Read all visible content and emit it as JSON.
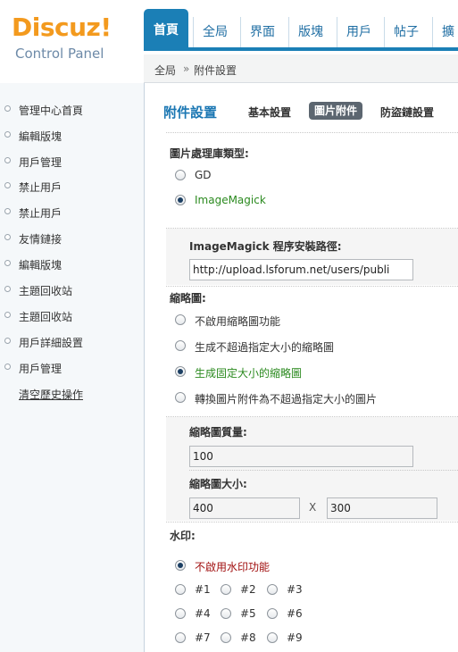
{
  "logo": {
    "title": "Discuz!",
    "subtitle": "Control Panel"
  },
  "top_tabs": [
    "首頁",
    "全局",
    "界面",
    "版塊",
    "用戶",
    "帖子",
    "擴"
  ],
  "breadcrumb": {
    "root": "全局",
    "sep": "»",
    "current": "附件設置"
  },
  "sidebar": {
    "items": [
      "管理中心首頁",
      "編輯版塊",
      "用戶管理",
      "禁止用戶",
      "禁止用戶",
      "友情鏈接",
      "編輯版塊",
      "主題回收站",
      "主題回收站",
      "用戶詳細設置",
      "用戶管理"
    ],
    "clear_history": "清空歷史操作"
  },
  "section": {
    "title": "附件設置",
    "tabs": [
      "基本設置",
      "圖片附件",
      "防盜鏈設置"
    ],
    "active_tab": "圖片附件"
  },
  "form": {
    "lib_label": "圖片處理庫類型:",
    "lib_options": [
      "GD",
      "ImageMagick"
    ],
    "lib_selected": "ImageMagick",
    "im_path_label": "ImageMagick 程序安裝路徑:",
    "im_path_value": "http://upload.lsforum.net/users/publi",
    "thumb_label": "縮略圖:",
    "thumb_options": [
      "不啟用縮略圖功能",
      "生成不超過指定大小的縮略圖",
      "生成固定大小的縮略圖",
      "轉換圖片附件為不超過指定大小的圖片"
    ],
    "thumb_selected": "生成固定大小的縮略圖",
    "quality_label": "縮略圖質量:",
    "quality_value": "100",
    "size_label": "縮略圖大小:",
    "size_width": "400",
    "size_x": "X",
    "size_height": "300",
    "watermark_label": "水印:",
    "watermark_disable": "不啟用水印功能",
    "watermark_positions": [
      "#1",
      "#2",
      "#3",
      "#4",
      "#5",
      "#6",
      "#7",
      "#8",
      "#9"
    ]
  }
}
